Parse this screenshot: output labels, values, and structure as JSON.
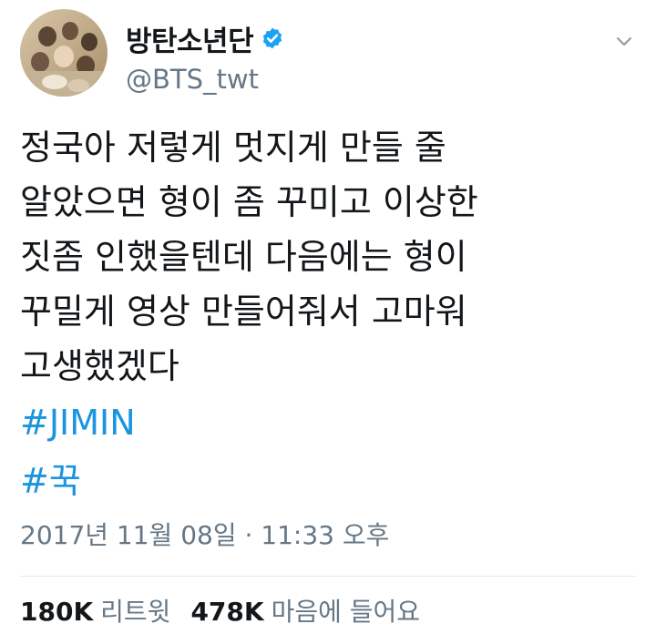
{
  "user": {
    "display_name": "방탄소년단",
    "handle": "@BTS_twt",
    "verified": true
  },
  "tweet": {
    "lines": [
      "정국아 저렇게 멋지게 만들 줄",
      "알았으면 형이 좀 꾸미고 이상한",
      "짓좀 인했을텐데 다음에는 형이",
      "꾸밀게 영상 만들어줘서 고마워",
      "고생했겠다"
    ],
    "hashtags": [
      "#JIMIN",
      "#꾹"
    ],
    "timestamp": "2017년 11월 08일 · 11:33 오후"
  },
  "stats": {
    "retweets_count": "180K",
    "retweets_label": "리트윗",
    "likes_count": "478K",
    "likes_label": "마음에 들어요"
  },
  "colors": {
    "accent": "#1b95e0",
    "text": "#14171a",
    "secondary": "#657786",
    "divider": "#e1e8ed",
    "verified": "#1da1f2"
  },
  "icons": {
    "verified": "verified-badge-icon",
    "caret": "chevron-down-icon"
  }
}
